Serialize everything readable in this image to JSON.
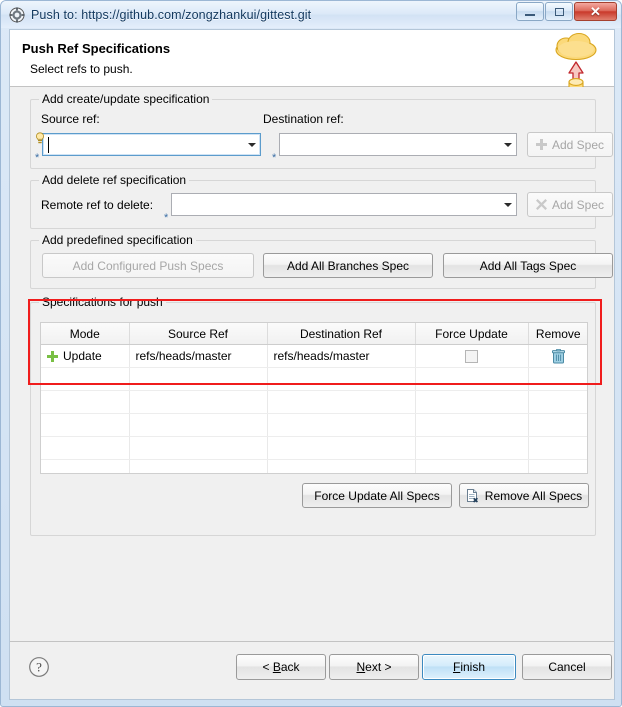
{
  "window": {
    "title": "Push to: https://github.com/zongzhankui/gittest.git",
    "icon": "eclipse-gear-icon",
    "controls": {
      "minimize": "Minimize",
      "maximize": "Maximize",
      "close": "Close"
    }
  },
  "header": {
    "title": "Push Ref Specifications",
    "subtitle": "Select refs to push.",
    "banner_icon": "cloud-push-icon"
  },
  "sections": {
    "create_update": {
      "legend": "Add create/update specification",
      "source_label": "Source ref:",
      "source_value": "",
      "source_decoration": "content-assist-bulb-icon",
      "source_required_marker": "*",
      "destination_label": "Destination ref:",
      "destination_value": "",
      "destination_required_marker": "*",
      "add_spec_label": "Add Spec",
      "add_spec_icon": "plus-icon",
      "add_spec_enabled": false
    },
    "delete_ref": {
      "legend": "Add delete ref specification",
      "remote_label": "Remote ref to delete:",
      "remote_value": "",
      "remote_required_marker": "*",
      "add_spec_label": "Add Spec",
      "add_spec_icon": "cross-delete-icon",
      "add_spec_enabled": false
    },
    "predefined": {
      "legend": "Add predefined specification",
      "configured_label": "Add Configured Push Specs",
      "configured_enabled": false,
      "all_branches_label": "Add All Branches Spec",
      "all_tags_label": "Add All Tags Spec"
    },
    "specs": {
      "legend": "Specifications for push",
      "highlight_color": "#f01c1c",
      "columns": [
        "Mode",
        "Source Ref",
        "Destination Ref",
        "Force Update",
        "Remove"
      ],
      "rows": [
        {
          "mode_icon": "green-plus-icon",
          "mode": "Update",
          "source_ref": "refs/heads/master",
          "destination_ref": "refs/heads/master",
          "force_update": false,
          "remove_icon": "trash-icon"
        }
      ],
      "empty_row_count": 7,
      "force_update_all_label": "Force Update All Specs",
      "remove_all_label": "Remove All Specs",
      "remove_all_icon": "remove-document-icon"
    }
  },
  "footer": {
    "help_icon": "help-question-icon",
    "back_label": "< Back",
    "back_mnemonic": "B",
    "next_label": "Next >",
    "next_mnemonic": "N",
    "finish_label": "Finish",
    "finish_mnemonic": "F",
    "cancel_label": "Cancel",
    "default_button": "Finish"
  }
}
